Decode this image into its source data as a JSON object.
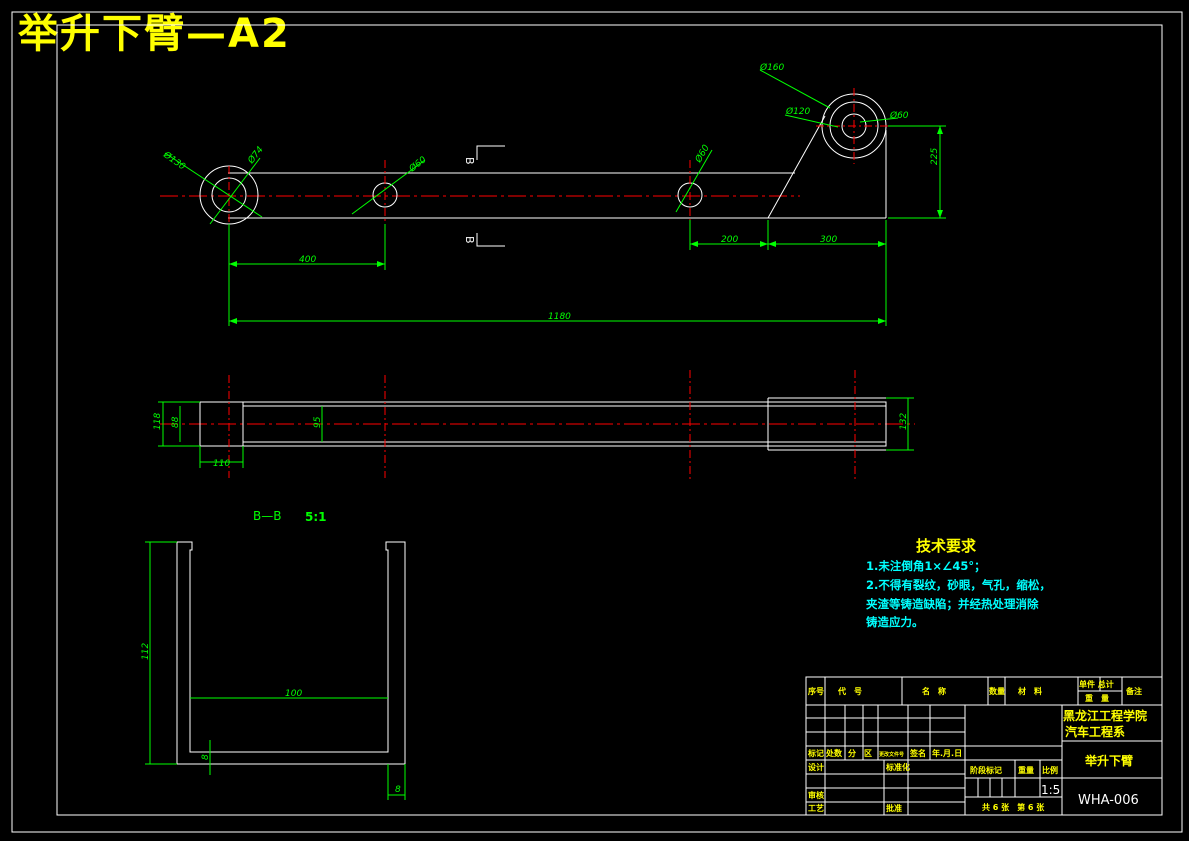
{
  "drawing_title": "举升下臂—A2",
  "front_view": {
    "dims": {
      "d130": "Ø130",
      "d74": "Ø74",
      "d60_mid": "Ø60",
      "d60_right": "Ø60",
      "d160": "Ø160",
      "d120": "Ø120",
      "d60_top": "Ø60",
      "h225": "225",
      "l400": "400",
      "l200": "200",
      "l300": "300",
      "l1180": "1180"
    },
    "section_mark": "B"
  },
  "top_view": {
    "dims": {
      "h118": "118",
      "h88": "88",
      "h95": "95",
      "h132": "132",
      "w110": "110"
    }
  },
  "section_view": {
    "label": "B—B",
    "scale": "5:1",
    "dims": {
      "h112": "112",
      "w100": "100",
      "t8": "8",
      "b8": "8"
    }
  },
  "tech_requirements": {
    "title": "技术要求",
    "lines": [
      "1.未注倒角1×∠45°；",
      "2.不得有裂纹，砂眼，气孔，缩松，",
      "夹渣等铸造缺陷；并经热处理消除",
      "铸造应力。"
    ]
  },
  "title_block": {
    "header": {
      "seq": "序号",
      "code": "代　号",
      "name": "名　称",
      "qty": "数量",
      "material": "材　料",
      "single_total": "单件 总计",
      "weight": "重　量",
      "remark": "备注"
    },
    "school": "黑龙江工程学院",
    "department": "汽车工程系",
    "part_name": "举升下臂",
    "drawing_no": "WHA-006",
    "row_labels": {
      "mark": "标记",
      "count": "处数",
      "zone": "分　区",
      "change_doc": "更改文件号",
      "signature": "签名",
      "date": "年.月.日",
      "design": "设计",
      "standardize": "标准化",
      "stage_mark": "阶段标记",
      "weight2": "重量",
      "scale": "比例",
      "review": "审核",
      "process": "工艺",
      "approve": "批准",
      "sheets": "共 6 张　第 6 张",
      "scale_value": "1:5"
    }
  }
}
